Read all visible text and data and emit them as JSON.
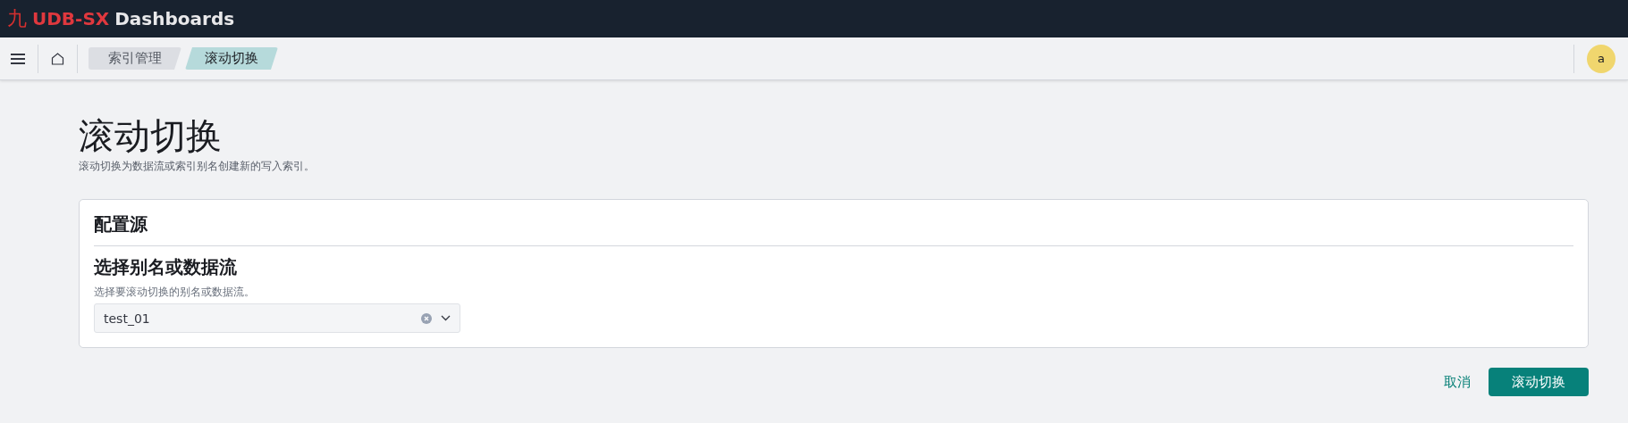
{
  "header": {
    "logo_mark": "九",
    "brand": "UDB-SX",
    "product": "Dashboards"
  },
  "breadcrumbs": [
    {
      "label": "索引管理",
      "selected": false
    },
    {
      "label": "滚动切换",
      "selected": true
    }
  ],
  "user": {
    "avatar": "a"
  },
  "page": {
    "title": "滚动切换",
    "description": "滚动切换为数据流或索引别名创建新的写入索引。"
  },
  "panel": {
    "title": "配置源",
    "section_title": "选择别名或数据流",
    "help": "选择要滚动切换的别名或数据流。",
    "select": {
      "value": "test_01"
    }
  },
  "actions": {
    "cancel": "取消",
    "submit": "滚动切换"
  }
}
